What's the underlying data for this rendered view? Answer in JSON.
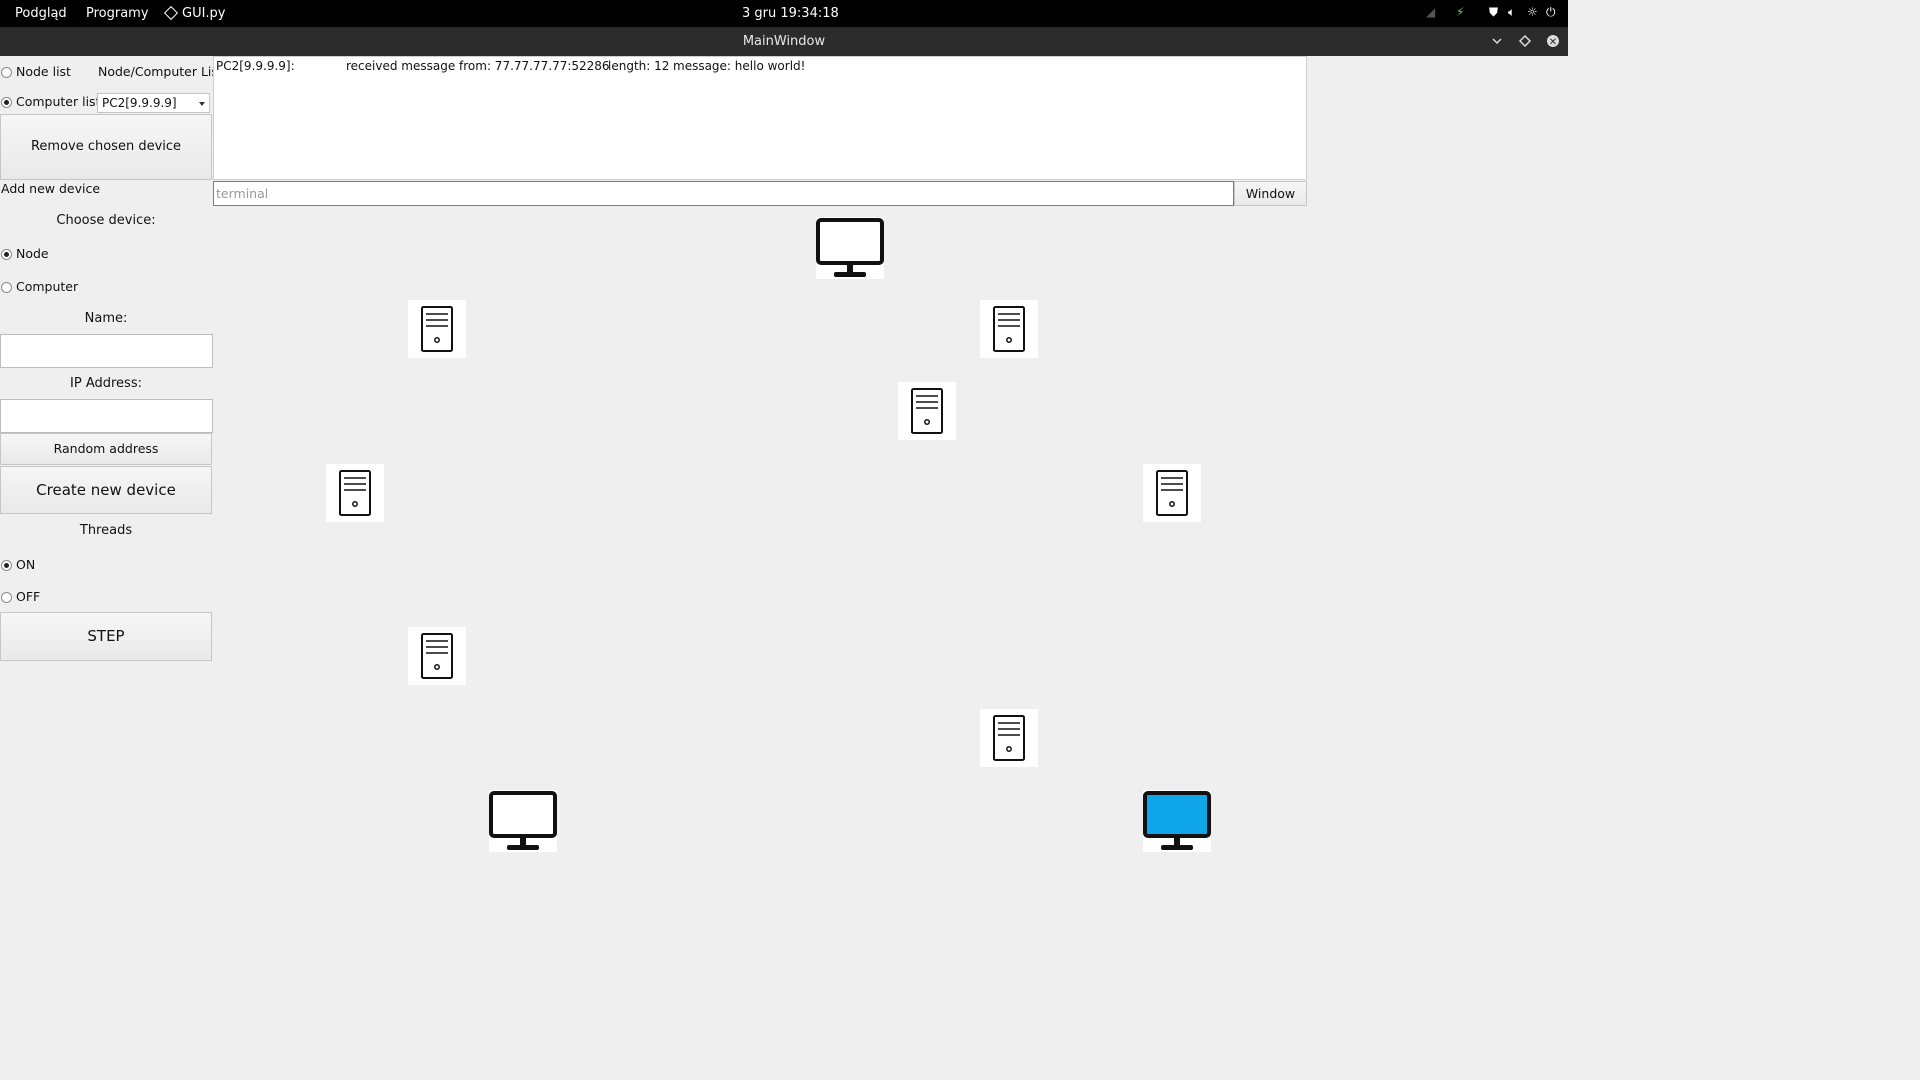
{
  "topbar": {
    "overview": "Podgląd",
    "programs": "Programy",
    "app_name": "GUI.py",
    "clock": "3 gru  19:34:18"
  },
  "window": {
    "title": "MainWindow"
  },
  "sidebar": {
    "node_list_label": "Node list",
    "list_header": "Node/Computer List",
    "computer_list_label": "Computer list",
    "selected_device": "PC2[9.9.9.9]",
    "remove_button": "Remove chosen device",
    "add_new_label": "Add new device",
    "choose_device_label": "Choose device:",
    "node_option": "Node",
    "computer_option": "Computer",
    "name_label": "Name:",
    "name_value": "",
    "ip_label": "IP Address:",
    "ip_value": "",
    "random_address_button": "Random address",
    "create_button": "Create new device",
    "threads_label": "Threads",
    "threads_on": "ON",
    "threads_off": "OFF",
    "step_button": "STEP",
    "selected_list": "computer",
    "selected_device_type": "node",
    "threads_state": "on"
  },
  "log": {
    "rows": [
      {
        "source": "PC2[9.9.9.9]:",
        "event": "received message from: 77.77.77.77:52286",
        "length": "length: 12",
        "message": "message: hello world!"
      }
    ]
  },
  "terminal": {
    "placeholder": "terminal",
    "value": "",
    "window_button": "Window"
  },
  "network": {
    "devices": [
      {
        "type": "computer",
        "icon": "monitor-icon",
        "selected": false
      },
      {
        "type": "node",
        "icon": "server-tower-icon"
      },
      {
        "type": "node",
        "icon": "server-tower-icon"
      },
      {
        "type": "node",
        "icon": "server-tower-icon"
      },
      {
        "type": "node",
        "icon": "server-tower-icon"
      },
      {
        "type": "node",
        "icon": "server-tower-icon"
      },
      {
        "type": "node",
        "icon": "server-tower-icon"
      },
      {
        "type": "node",
        "icon": "server-tower-icon"
      },
      {
        "type": "computer",
        "icon": "monitor-icon",
        "selected": false
      },
      {
        "type": "computer",
        "icon": "monitor-icon",
        "selected": true
      }
    ],
    "colors": {
      "selected_screen": "#0ea5e9",
      "accent": "#3d8ad9"
    }
  }
}
